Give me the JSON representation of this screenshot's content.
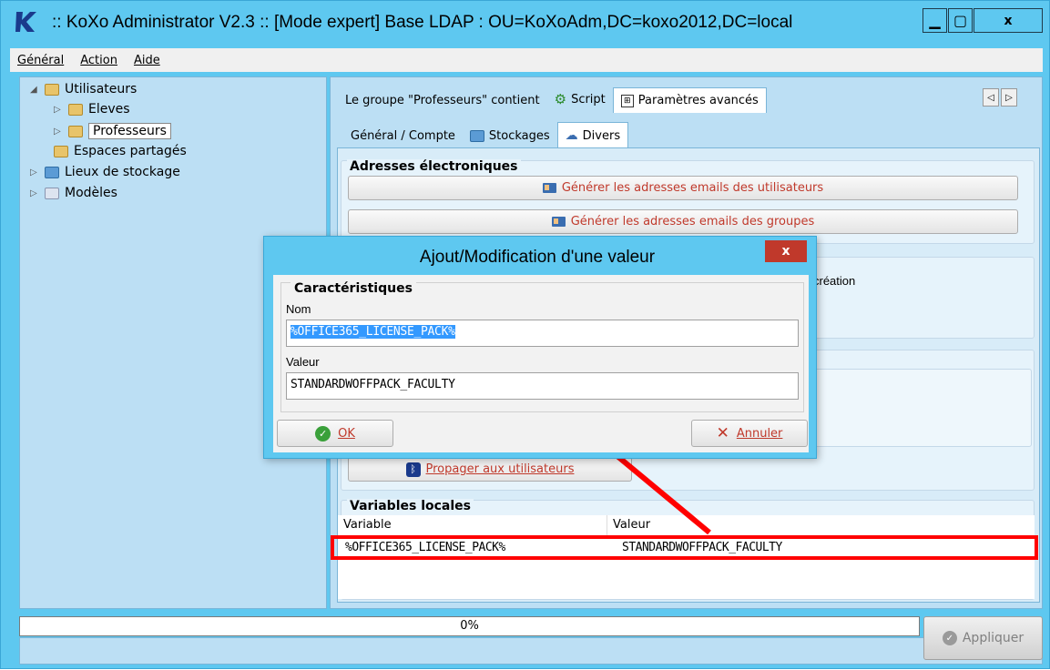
{
  "window": {
    "title": ":: KoXo Administrator V2.3 :: [Mode expert] Base LDAP : OU=KoXoAdm,DC=koxo2012,DC=local",
    "minimize": "▁",
    "maximize": "▢",
    "close": "x"
  },
  "menu": {
    "items": [
      "Général",
      "Action",
      "Aide"
    ]
  },
  "tree": {
    "items": [
      {
        "label": "Utilisateurs",
        "arrow": "◢"
      },
      {
        "label": "Eleves",
        "arrow": "▷"
      },
      {
        "label": "Professeurs",
        "arrow": "▷"
      },
      {
        "label": "Espaces partagés",
        "arrow": ""
      },
      {
        "label": "Lieux de stockage",
        "arrow": "▷"
      },
      {
        "label": "Modèles",
        "arrow": "▷"
      }
    ]
  },
  "tabs_top": {
    "items": [
      "Le groupe \"Professeurs\" contient",
      "Script",
      "Paramètres avancés"
    ],
    "nav_prev": "◁",
    "nav_next": "▷"
  },
  "tabs_sub": {
    "items": [
      "Général / Compte",
      "Stockages",
      "Divers"
    ]
  },
  "emails": {
    "title": "Adresses électroniques",
    "btn_users": "Générer les adresses emails des utilisateurs",
    "btn_groups": "Générer les adresses emails des groupes"
  },
  "partial": {
    "creation": "création",
    "propagate": "Propager aux utilisateurs"
  },
  "local_vars": {
    "title": "Variables locales",
    "col_variable": "Variable",
    "col_value": "Valeur",
    "row_variable": "%OFFICE365_LICENSE_PACK%",
    "row_value": "STANDARDWOFFPACK_FACULTY"
  },
  "status": {
    "progress_text": "0%",
    "progress": 0,
    "apply_label": "Appliquer"
  },
  "dialog": {
    "title": "Ajout/Modification d'une valeur",
    "close": "x",
    "group_title": "Caractéristiques",
    "name_label": "Nom",
    "name_value": "%OFFICE365_LICENSE_PACK%",
    "value_label": "Valeur",
    "value_value": "STANDARDWOFFPACK_FACULTY",
    "ok": "OK",
    "cancel": "Annuler"
  },
  "colors": {
    "window_bg": "#5ec8f0",
    "panel_bg": "#bcdff4",
    "highlight": "#ff0000",
    "button_text": "#c0392b"
  }
}
